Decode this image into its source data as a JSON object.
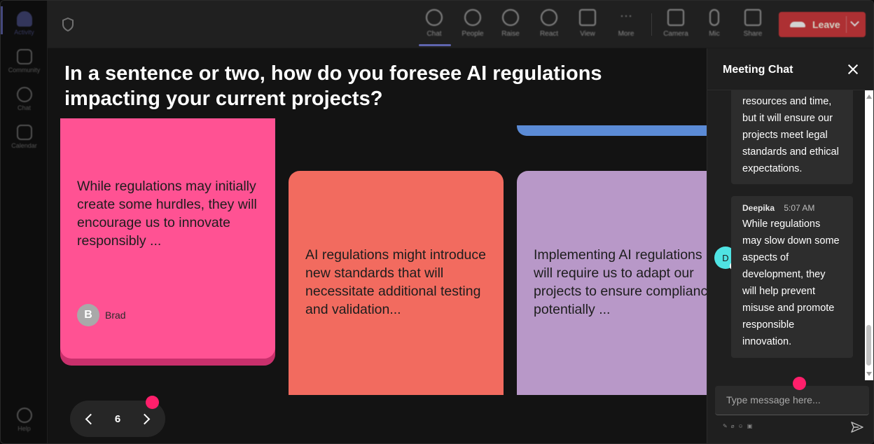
{
  "rail": {
    "items": [
      {
        "label": "Activity",
        "icon": "bell-icon"
      },
      {
        "label": "Community",
        "icon": "community-icon"
      },
      {
        "label": "Chat",
        "icon": "chat-icon"
      },
      {
        "label": "Calendar",
        "icon": "calendar-icon"
      },
      {
        "label": "Help",
        "icon": "help-icon"
      }
    ]
  },
  "toolbar": {
    "chat": "Chat",
    "people": "People",
    "raise": "Raise",
    "react": "React",
    "view": "View",
    "more": "More",
    "camera": "Camera",
    "mic": "Mic",
    "share": "Share",
    "leave": "Leave"
  },
  "stage": {
    "question": "In a sentence or two, how do you foresee AI regulations impacting your current projects?",
    "cards": [
      {
        "text": "While regulations may initially create some hurdles, they will encourage us to innovate responsibly ...",
        "author": "Brad",
        "author_initial": "B",
        "color": "#ff5293"
      },
      {
        "text": "AI regulations might introduce new standards that will necessitate additional testing and validation...",
        "color": "#f26b5f"
      },
      {
        "text": "Implementing AI regulations will require us to adapt our projects to ensure compliance, potentially ...",
        "color": "#b898c8"
      }
    ],
    "pager": {
      "current": "6"
    }
  },
  "chat": {
    "title": "Meeting Chat",
    "messages": [
      {
        "text": "resources and time, but it will ensure our projects meet legal standards and ethical expectations."
      },
      {
        "sender": "Deepika",
        "initial": "D",
        "time": "5:07 AM",
        "text": "While regulations may slow down some aspects of development, they will help prevent misuse and promote responsible innovation."
      }
    ],
    "compose_placeholder": "Type message here..."
  },
  "colors": {
    "accent": "#7b83eb",
    "leave": "#d13438",
    "notification_dot": "#ff1f6b"
  }
}
